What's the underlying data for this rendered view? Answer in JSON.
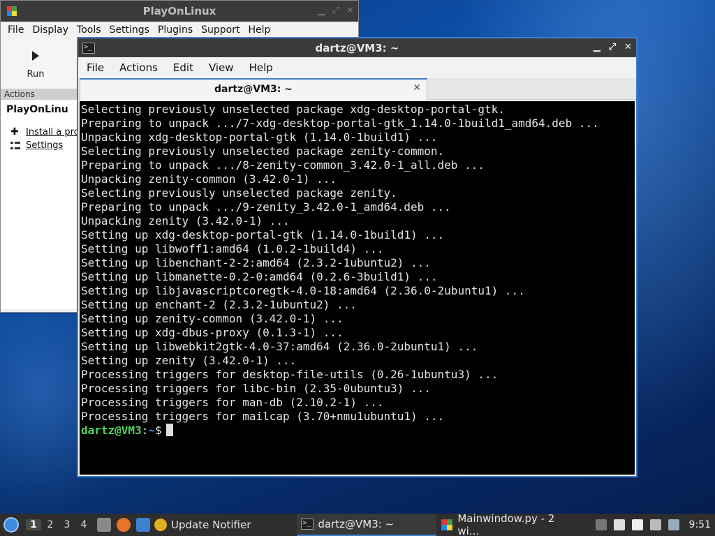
{
  "playonlinux": {
    "title": "PlayOnLinux",
    "menu": [
      "File",
      "Display",
      "Tools",
      "Settings",
      "Plugins",
      "Support",
      "Help"
    ],
    "toolbar_run_label": "Run",
    "actions_header": "Actions",
    "sidebar_title": "PlayOnLinu",
    "links": [
      "Install a pro",
      "Settings"
    ]
  },
  "terminal": {
    "title": "dartz@VM3: ~",
    "menu": [
      "File",
      "Actions",
      "Edit",
      "View",
      "Help"
    ],
    "tab_label": "dartz@VM3: ~",
    "lines": [
      "Selecting previously unselected package xdg-desktop-portal-gtk.",
      "Preparing to unpack .../7-xdg-desktop-portal-gtk_1.14.0-1build1_amd64.deb ...",
      "Unpacking xdg-desktop-portal-gtk (1.14.0-1build1) ...",
      "Selecting previously unselected package zenity-common.",
      "Preparing to unpack .../8-zenity-common_3.42.0-1_all.deb ...",
      "Unpacking zenity-common (3.42.0-1) ...",
      "Selecting previously unselected package zenity.",
      "Preparing to unpack .../9-zenity_3.42.0-1_amd64.deb ...",
      "Unpacking zenity (3.42.0-1) ...",
      "Setting up xdg-desktop-portal-gtk (1.14.0-1build1) ...",
      "Setting up libwoff1:amd64 (1.0.2-1build4) ...",
      "Setting up libenchant-2-2:amd64 (2.3.2-1ubuntu2) ...",
      "Setting up libmanette-0.2-0:amd64 (0.2.6-3build1) ...",
      "Setting up libjavascriptcoregtk-4.0-18:amd64 (2.36.0-2ubuntu1) ...",
      "Setting up enchant-2 (2.3.2-1ubuntu2) ...",
      "Setting up zenity-common (3.42.0-1) ...",
      "Setting up xdg-dbus-proxy (0.1.3-1) ...",
      "Setting up libwebkit2gtk-4.0-37:amd64 (2.36.0-2ubuntu1) ...",
      "Setting up zenity (3.42.0-1) ...",
      "Processing triggers for desktop-file-utils (0.26-1ubuntu3) ...",
      "Processing triggers for libc-bin (2.35-0ubuntu3) ...",
      "Processing triggers for man-db (2.10.2-1) ...",
      "Processing triggers for mailcap (3.70+nmu1ubuntu1) ..."
    ],
    "prompt_user": "dartz@VM3",
    "prompt_sep": ":",
    "prompt_path": "~",
    "prompt_symbol": "$"
  },
  "taskbar": {
    "workspaces": [
      "1",
      "2",
      "3",
      "4"
    ],
    "tasks": [
      "Update Notifier",
      "dartz@VM3: ~",
      "Mainwindow.py - 2 wi..."
    ],
    "clock": "9:51"
  }
}
